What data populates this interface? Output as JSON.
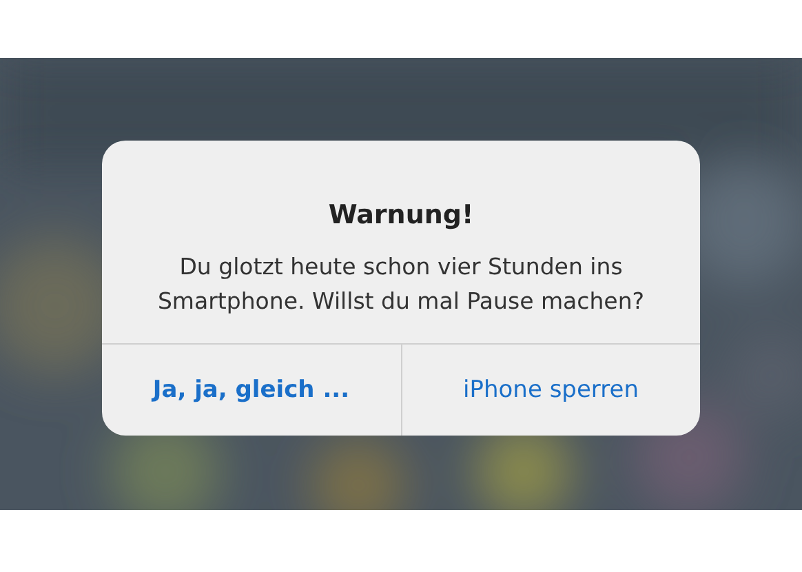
{
  "alert": {
    "title": "Warnung!",
    "message": "Du glotzt heute schon vier Stunden ins Smartphone. Willst du mal Pause machen?",
    "buttons": [
      {
        "label": "Ja, ja, gleich ...",
        "preferred": true
      },
      {
        "label": "iPhone sperren",
        "preferred": false
      }
    ]
  }
}
